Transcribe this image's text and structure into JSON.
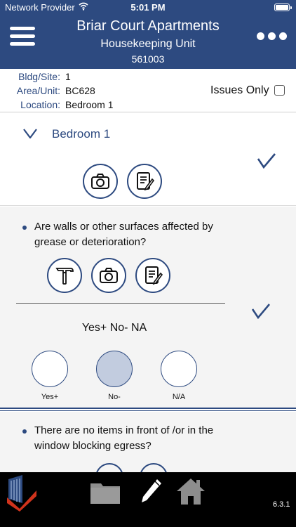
{
  "status_bar": {
    "carrier": "Network Provider",
    "time": "5:01 PM",
    "battery_level": 1.0
  },
  "header": {
    "title": "Briar Court Apartments",
    "subtitle": "Housekeeping Unit",
    "code": "561003"
  },
  "info": {
    "rows": [
      {
        "label": "Bldg/Site:",
        "value": "1"
      },
      {
        "label": "Area/Unit:",
        "value": "BC628"
      },
      {
        "label": "Location:",
        "value": "Bedroom 1"
      }
    ],
    "issues_only_label": "Issues Only",
    "issues_only_checked": false
  },
  "section": {
    "title": "Bedroom 1",
    "completed": true
  },
  "question1": {
    "text": "Are walls or other surfaces affected by grease or deterioration?",
    "answer_label": "Yes+ No- NA",
    "options": [
      {
        "label": "Yes+",
        "selected": false
      },
      {
        "label": "No-",
        "selected": true
      },
      {
        "label": "N/A",
        "selected": false
      }
    ],
    "completed": true
  },
  "question2": {
    "text": "There are no items in front of /or in the window blocking egress?"
  },
  "tabbar": {
    "version": "6.3.1"
  },
  "colors": {
    "brand": "#2d4a80",
    "accent": "#d0331c",
    "selected": "#c2ccdf"
  }
}
